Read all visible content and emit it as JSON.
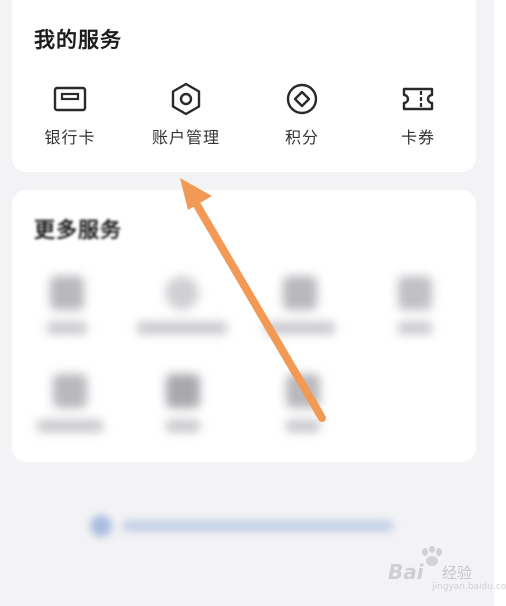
{
  "my_services": {
    "title": "我的服务",
    "items": [
      {
        "label": "银行卡",
        "icon": "bank-card-icon"
      },
      {
        "label": "账户管理",
        "icon": "hexagon-settings-icon"
      },
      {
        "label": "积分",
        "icon": "diamond-coin-icon"
      },
      {
        "label": "卡券",
        "icon": "coupon-ticket-icon"
      }
    ]
  },
  "more_services": {
    "title": "更多服务"
  },
  "colors": {
    "background": "#f3f3f5",
    "card": "#ffffff",
    "arrow": "#f29a55",
    "text": "#1d1d1f"
  },
  "watermark": {
    "brand": "Bai",
    "sub": "经验",
    "url": "jingyan.baidu.com"
  }
}
